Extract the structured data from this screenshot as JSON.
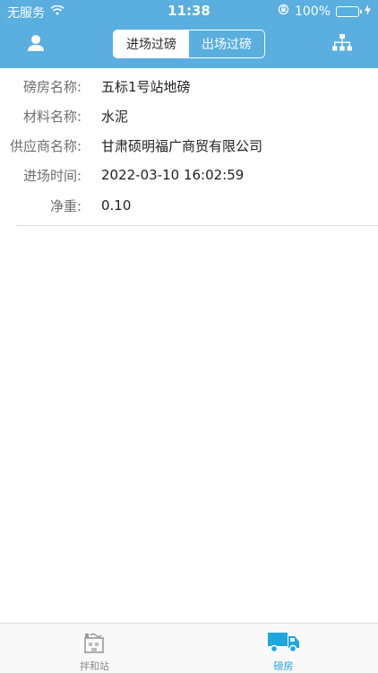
{
  "status_bar": {
    "carrier": "无服务",
    "time": "11:38",
    "battery": "100%"
  },
  "nav": {
    "segments": [
      {
        "label": "进场过磅",
        "active": true
      },
      {
        "label": "出场过磅",
        "active": false
      }
    ]
  },
  "record": {
    "fields": [
      {
        "label": "磅房名称:",
        "value": "五标1号站地磅"
      },
      {
        "label": "材料名称:",
        "value": "水泥"
      },
      {
        "label": "供应商名称:",
        "value": "甘肃硕明福广商贸有限公司"
      },
      {
        "label": "进场时间:",
        "value": "2022-03-10 16:02:59"
      },
      {
        "label": "净重:",
        "value": "0.10"
      }
    ]
  },
  "tabbar": {
    "items": [
      {
        "label": "拌和站",
        "icon": "building-icon",
        "active": false
      },
      {
        "label": "磅房",
        "icon": "truck-icon",
        "active": true
      }
    ]
  },
  "colors": {
    "header": "#5aaee0",
    "active_tab": "#1ea6df",
    "inactive_tab": "#888888"
  }
}
